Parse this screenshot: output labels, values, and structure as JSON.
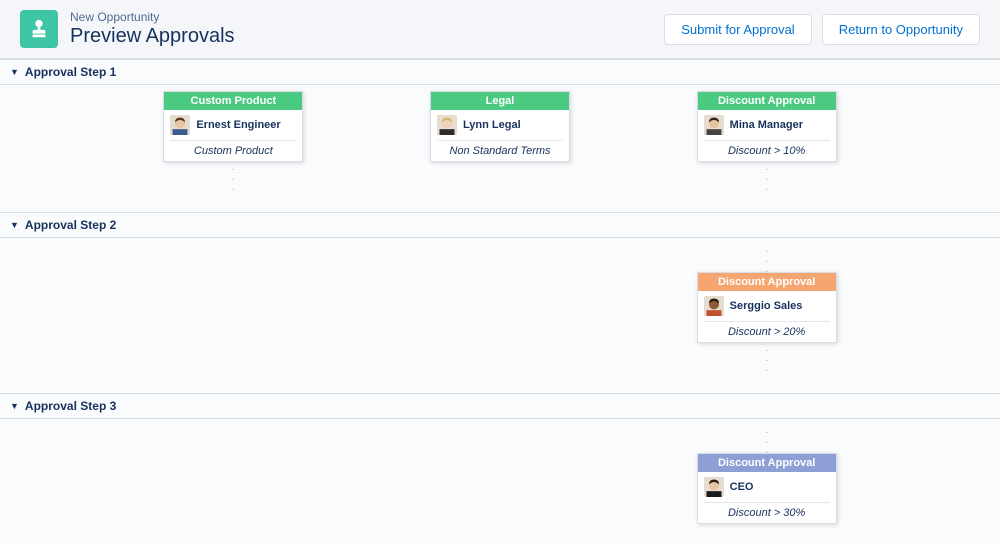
{
  "header": {
    "subtitle": "New Opportunity",
    "title": "Preview Approvals",
    "submit_label": "Submit for Approval",
    "return_label": "Return to Opportunity"
  },
  "steps": [
    {
      "label": "Approval Step 1",
      "columns": [
        {
          "title": "Custom Product",
          "color": "green",
          "approver": "Ernest Engineer",
          "rule": "Custom Product",
          "avatar": "male1",
          "dots": true
        },
        {
          "title": "Legal",
          "color": "green",
          "approver": "Lynn Legal",
          "rule": "Non Standard Terms",
          "avatar": "female1",
          "dots": false
        },
        {
          "title": "Discount Approval",
          "color": "green",
          "approver": "Mina Manager",
          "rule": "Discount > 10%",
          "avatar": "female2",
          "dots": true
        }
      ]
    },
    {
      "label": "Approval Step 2",
      "columns": [
        null,
        null,
        {
          "title": "Discount Approval",
          "color": "orange",
          "approver": "Serggio Sales",
          "rule": "Discount > 20%",
          "avatar": "male2",
          "dots": true
        }
      ]
    },
    {
      "label": "Approval Step 3",
      "columns": [
        null,
        null,
        {
          "title": "Discount Approval",
          "color": "purple",
          "approver": "CEO",
          "rule": "Discount > 30%",
          "avatar": "male3",
          "dots": false
        }
      ]
    }
  ],
  "avatars": {
    "male1": {
      "skin": "#e8c4a0",
      "hair": "#5b3a1f",
      "shirt": "#3b5c8f"
    },
    "female1": {
      "skin": "#f0d2b8",
      "hair": "#d9b56a",
      "shirt": "#2c2c2c"
    },
    "female2": {
      "skin": "#e8c4a0",
      "hair": "#3a2518",
      "shirt": "#444"
    },
    "male2": {
      "skin": "#8d5a3a",
      "hair": "#2a1a0f",
      "shirt": "#c05030"
    },
    "male3": {
      "skin": "#e8c4a0",
      "hair": "#2a1a0f",
      "shirt": "#1a1a1a"
    }
  }
}
